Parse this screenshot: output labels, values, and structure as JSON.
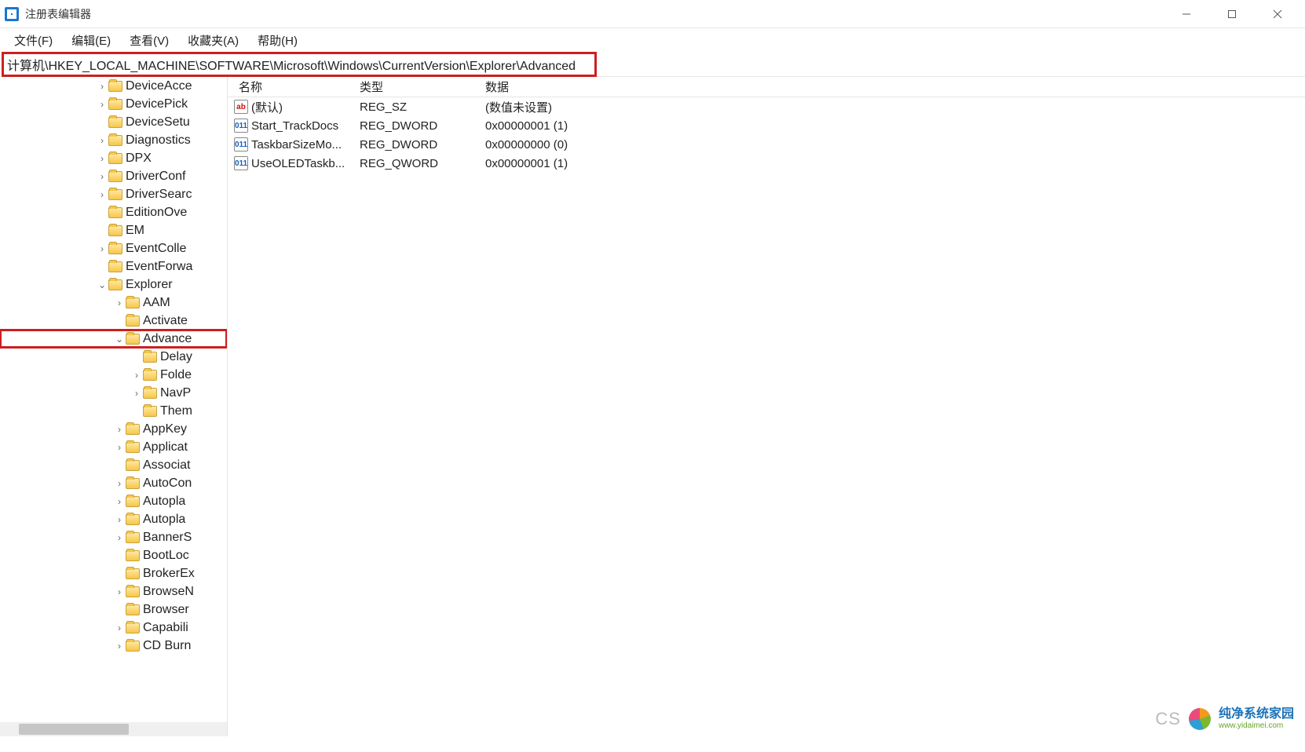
{
  "window": {
    "title": "注册表编辑器"
  },
  "menu": {
    "file": "文件(F)",
    "edit": "编辑(E)",
    "view": "查看(V)",
    "favorites": "收藏夹(A)",
    "help": "帮助(H)"
  },
  "address": {
    "path": "计算机\\HKEY_LOCAL_MACHINE\\SOFTWARE\\Microsoft\\Windows\\CurrentVersion\\Explorer\\Advanced"
  },
  "tree": [
    {
      "indent": 5,
      "exp": ">",
      "label": "DeviceAcce"
    },
    {
      "indent": 5,
      "exp": ">",
      "label": "DevicePick"
    },
    {
      "indent": 5,
      "exp": "",
      "label": "DeviceSetu"
    },
    {
      "indent": 5,
      "exp": ">",
      "label": "Diagnostics"
    },
    {
      "indent": 5,
      "exp": ">",
      "label": "DPX"
    },
    {
      "indent": 5,
      "exp": ">",
      "label": "DriverConf"
    },
    {
      "indent": 5,
      "exp": ">",
      "label": "DriverSearc"
    },
    {
      "indent": 5,
      "exp": "",
      "label": "EditionOve"
    },
    {
      "indent": 5,
      "exp": "",
      "label": "EM"
    },
    {
      "indent": 5,
      "exp": ">",
      "label": "EventColle"
    },
    {
      "indent": 5,
      "exp": "",
      "label": "EventForwa"
    },
    {
      "indent": 5,
      "exp": "v",
      "label": "Explorer"
    },
    {
      "indent": 6,
      "exp": ">",
      "label": "AAM"
    },
    {
      "indent": 6,
      "exp": "",
      "label": "Activate"
    },
    {
      "indent": 6,
      "exp": "v",
      "label": "Advance",
      "hl": true
    },
    {
      "indent": 7,
      "exp": "",
      "label": "Delay"
    },
    {
      "indent": 7,
      "exp": ">",
      "label": "Folde"
    },
    {
      "indent": 7,
      "exp": ">",
      "label": "NavP"
    },
    {
      "indent": 7,
      "exp": "",
      "label": "Them"
    },
    {
      "indent": 6,
      "exp": ">",
      "label": "AppKey"
    },
    {
      "indent": 6,
      "exp": ">",
      "label": "Applicat"
    },
    {
      "indent": 6,
      "exp": "",
      "label": "Associat"
    },
    {
      "indent": 6,
      "exp": ">",
      "label": "AutoCon"
    },
    {
      "indent": 6,
      "exp": ">",
      "label": "Autopla"
    },
    {
      "indent": 6,
      "exp": ">",
      "label": "Autopla"
    },
    {
      "indent": 6,
      "exp": ">",
      "label": "BannerS"
    },
    {
      "indent": 6,
      "exp": "",
      "label": "BootLoc"
    },
    {
      "indent": 6,
      "exp": "",
      "label": "BrokerEx"
    },
    {
      "indent": 6,
      "exp": ">",
      "label": "BrowseN"
    },
    {
      "indent": 6,
      "exp": "",
      "label": "Browser"
    },
    {
      "indent": 6,
      "exp": ">",
      "label": "Capabili"
    },
    {
      "indent": 6,
      "exp": ">",
      "label": "CD Burn"
    }
  ],
  "list": {
    "columns": {
      "name": "名称",
      "type": "类型",
      "data": "数据"
    },
    "rows": [
      {
        "icon": "sz",
        "name": "(默认)",
        "type": "REG_SZ",
        "data": "(数值未设置)"
      },
      {
        "icon": "bin",
        "name": "Start_TrackDocs",
        "type": "REG_DWORD",
        "data": "0x00000001 (1)"
      },
      {
        "icon": "bin",
        "name": "TaskbarSizeMo...",
        "type": "REG_DWORD",
        "data": "0x00000000 (0)"
      },
      {
        "icon": "bin",
        "name": "UseOLEDTaskb...",
        "type": "REG_QWORD",
        "data": "0x00000001 (1)"
      }
    ]
  },
  "watermark": {
    "cs": "CS",
    "zh": "纯净系统家园",
    "en": "www.yidaimei.com"
  }
}
